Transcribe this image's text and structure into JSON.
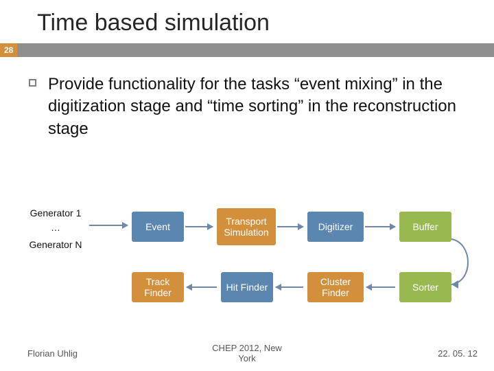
{
  "title": "Time based simulation",
  "page_number": "28",
  "body": "Provide functionality for the tasks “event mixing” in the digitization stage and “time sorting” in the reconstruction stage",
  "nodes": {
    "gen1": "Generator 1",
    "dots": "…",
    "genN": "Generator N",
    "event": "Event",
    "transport": "Transport Simulation",
    "digitizer": "Digitizer",
    "buffer": "Buffer",
    "track_finder": "Track Finder",
    "hit_finder": "Hit Finder",
    "cluster_finder": "Cluster Finder",
    "sorter": "Sorter"
  },
  "footer": {
    "author": "Florian Uhlig",
    "venue_line1": "CHEP 2012, New",
    "venue_line2": "York",
    "date": "22. 05. 12"
  },
  "chart_data": {
    "type": "diagram",
    "title": "Time based simulation pipeline",
    "nodes": [
      {
        "id": "gen1",
        "label": "Generator 1",
        "style": "plain"
      },
      {
        "id": "genN",
        "label": "Generator N",
        "style": "plain"
      },
      {
        "id": "event",
        "label": "Event",
        "style": "blue"
      },
      {
        "id": "transport",
        "label": "Transport Simulation",
        "style": "brown"
      },
      {
        "id": "digitizer",
        "label": "Digitizer",
        "style": "blue"
      },
      {
        "id": "buffer",
        "label": "Buffer",
        "style": "green"
      },
      {
        "id": "sorter",
        "label": "Sorter",
        "style": "green"
      },
      {
        "id": "cluster_finder",
        "label": "Cluster Finder",
        "style": "brown"
      },
      {
        "id": "hit_finder",
        "label": "Hit Finder",
        "style": "blue"
      },
      {
        "id": "track_finder",
        "label": "Track Finder",
        "style": "brown"
      }
    ],
    "edges": [
      [
        "gen1",
        "event"
      ],
      [
        "genN",
        "event"
      ],
      [
        "event",
        "transport"
      ],
      [
        "transport",
        "digitizer"
      ],
      [
        "digitizer",
        "buffer"
      ],
      [
        "buffer",
        "sorter"
      ],
      [
        "sorter",
        "cluster_finder"
      ],
      [
        "cluster_finder",
        "hit_finder"
      ],
      [
        "hit_finder",
        "track_finder"
      ]
    ]
  }
}
